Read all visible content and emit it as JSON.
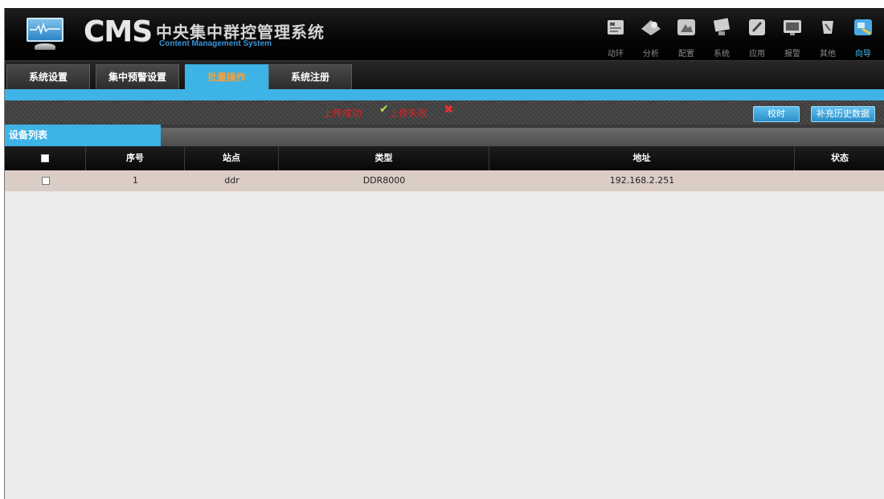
{
  "app": {
    "logo_main": "CMS",
    "logo_cn": "中央集中群控管理系统",
    "logo_en": "Content Management System"
  },
  "topnav": [
    {
      "label": "动环",
      "icon": "monitor-panel-icon"
    },
    {
      "label": "分析",
      "icon": "analysis-icon"
    },
    {
      "label": "配置",
      "icon": "config-icon"
    },
    {
      "label": "系统",
      "icon": "system-icon"
    },
    {
      "label": "应用",
      "icon": "application-icon"
    },
    {
      "label": "报警",
      "icon": "alarm-icon"
    },
    {
      "label": "其他",
      "icon": "other-icon"
    },
    {
      "label": "向导",
      "icon": "wizard-icon",
      "active": true
    }
  ],
  "tabs": [
    {
      "label": "系统设置"
    },
    {
      "label": "集中预警设置"
    },
    {
      "label": "批量操作",
      "active": true
    },
    {
      "label": "系统注册"
    }
  ],
  "status": {
    "ok_text": "上传成功",
    "fail_text": "上传失败",
    "ok_mark": "✔",
    "fail_mark": "✖"
  },
  "buttons": {
    "sync": "校时",
    "history": "补充历史数据"
  },
  "section": {
    "title": "设备列表"
  },
  "table": {
    "columns": [
      "",
      "序号",
      "站点",
      "类型",
      "地址",
      "状态"
    ],
    "rows": [
      {
        "index": "1",
        "site": "ddr",
        "type": "DDR8000",
        "address": "192.168.2.251",
        "status": ""
      }
    ]
  },
  "colors": {
    "accent": "#3db3e6",
    "active_tab_text": "#f5a03a",
    "status_red": "#dd2222",
    "row_bg": "#dcccc6"
  }
}
